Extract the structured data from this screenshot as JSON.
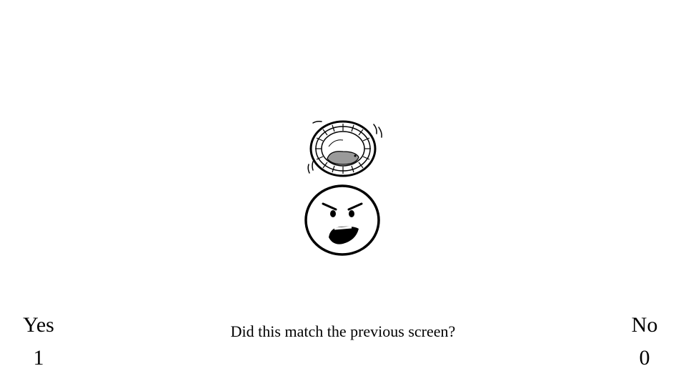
{
  "stimulus": {
    "top_icon": "hamster-wheel-icon",
    "bottom_icon": "angry-face-icon"
  },
  "question": "Did this match the previous screen?",
  "options": {
    "yes": {
      "label": "Yes",
      "key": "1"
    },
    "no": {
      "label": "No",
      "key": "0"
    }
  },
  "colors": {
    "background": "#ffffff",
    "ink": "#000000",
    "hamster": "#9a9a9a"
  }
}
